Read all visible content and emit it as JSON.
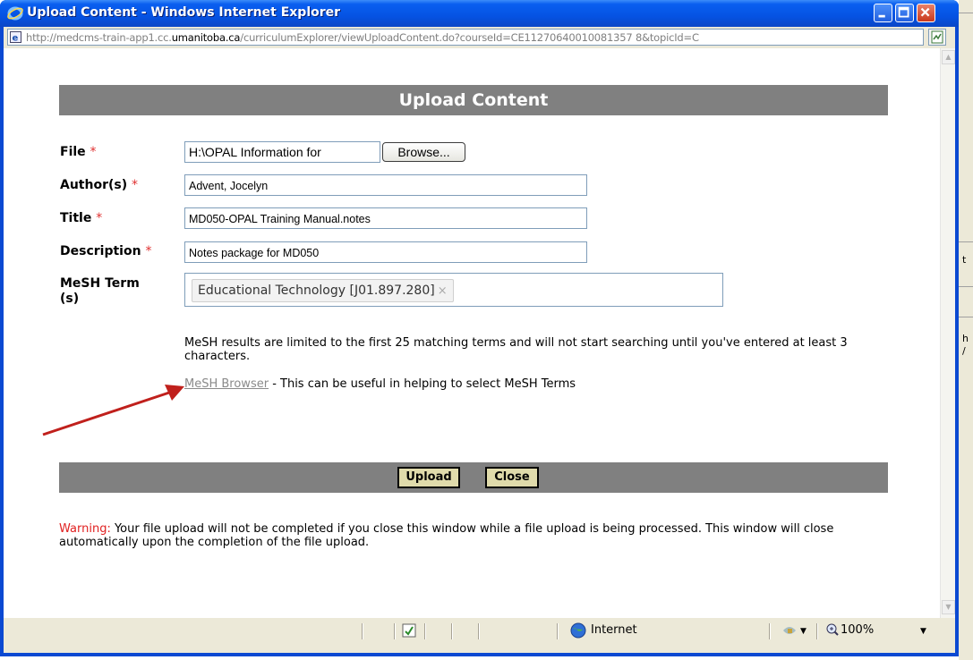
{
  "window": {
    "title": "Upload Content - Windows Internet Explorer",
    "url_prefix": "http://medcms-train-app1.cc.",
    "url_domain": "umanitoba.ca",
    "url_suffix": "/curriculumExplorer/viewUploadContent.do?courseId=CE11270640010081357 8&topicId=C"
  },
  "header": {
    "title": "Upload Content"
  },
  "form": {
    "required_mark": "*",
    "file": {
      "label": "File",
      "value": "H:\\OPAL Information for",
      "browse_label": "Browse..."
    },
    "authors": {
      "label": "Author(s)",
      "value": "Advent, Jocelyn"
    },
    "title": {
      "label": "Title",
      "value": "MD050-OPAL Training Manual.notes"
    },
    "description": {
      "label": "Description",
      "value": "Notes package for MD050"
    },
    "mesh": {
      "label_line1": "MeSH Term",
      "label_line2": "(s)",
      "chip": "Educational Technology [J01.897.280]",
      "chip_remove": "×"
    },
    "mesh_note": "MeSH results are limited to the first 25 matching terms and will not start searching until you've entered at least 3 characters.",
    "mesh_browser_link": "MeSH Browser",
    "mesh_browser_text": " - This can be useful in helping to select MeSH Terms"
  },
  "buttons": {
    "upload": "Upload",
    "close": "Close"
  },
  "warning": {
    "prefix": "Warning:",
    "text": " Your file upload will not be completed if you close this window while a file upload is being processed. This window will close automatically upon the completion of the file upload."
  },
  "statusbar": {
    "zone": "Internet",
    "zoom": "100%"
  },
  "icons": [
    "ie-logo-icon",
    "page-icon",
    "compatibility-icon",
    "internet-globe-icon",
    "protected-mode-icon",
    "zoom-icon",
    "minimize-icon",
    "maximize-icon",
    "close-icon"
  ],
  "colors": {
    "title_blue": "#0553e3",
    "header_gray": "#808080",
    "button_tan": "#e0dbab",
    "required_red": "#e03030"
  }
}
